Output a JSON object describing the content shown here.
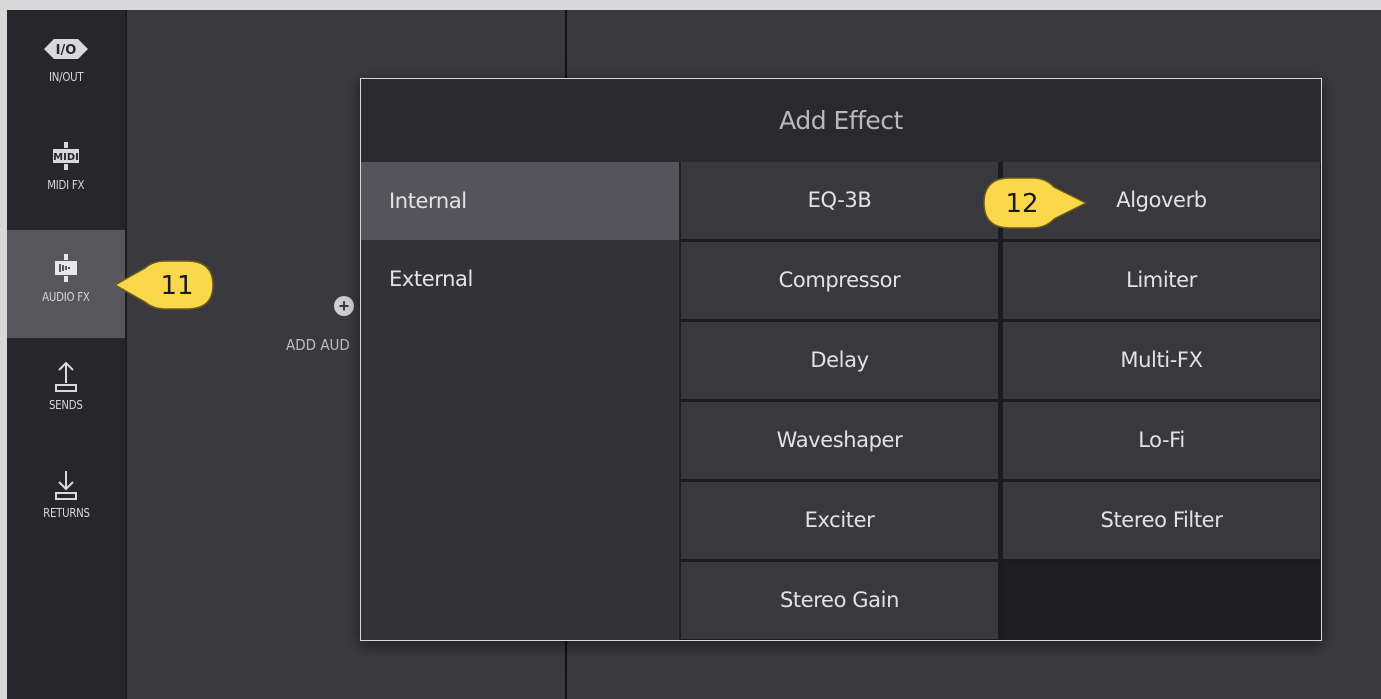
{
  "sidebar": {
    "items": [
      {
        "label": "IN/OUT",
        "icon": "in-out-icon",
        "active": false
      },
      {
        "label": "MIDI FX",
        "icon": "midi-icon",
        "active": false
      },
      {
        "label": "AUDIO FX",
        "icon": "audio-fx-icon",
        "active": true
      },
      {
        "label": "SENDS",
        "icon": "sends-icon",
        "active": false
      },
      {
        "label": "RETURNS",
        "icon": "returns-icon",
        "active": false
      }
    ]
  },
  "track": {
    "add_audio_label": "ADD AUD"
  },
  "dialog": {
    "title": "Add Effect",
    "categories": [
      {
        "label": "Internal",
        "active": true
      },
      {
        "label": "External",
        "active": false
      }
    ],
    "effects": [
      "EQ-3B",
      "Algoverb",
      "Compressor",
      "Limiter",
      "Delay",
      "Multi-FX",
      "Waveshaper",
      "Lo-Fi",
      "Exciter",
      "Stereo Filter",
      "Stereo Gain"
    ]
  },
  "callouts": {
    "c11": "11",
    "c12": "12"
  },
  "colors": {
    "callout_fill": "#fbd84a",
    "callout_stroke": "#6b5a1a",
    "active_sidebar": "#57565b"
  }
}
